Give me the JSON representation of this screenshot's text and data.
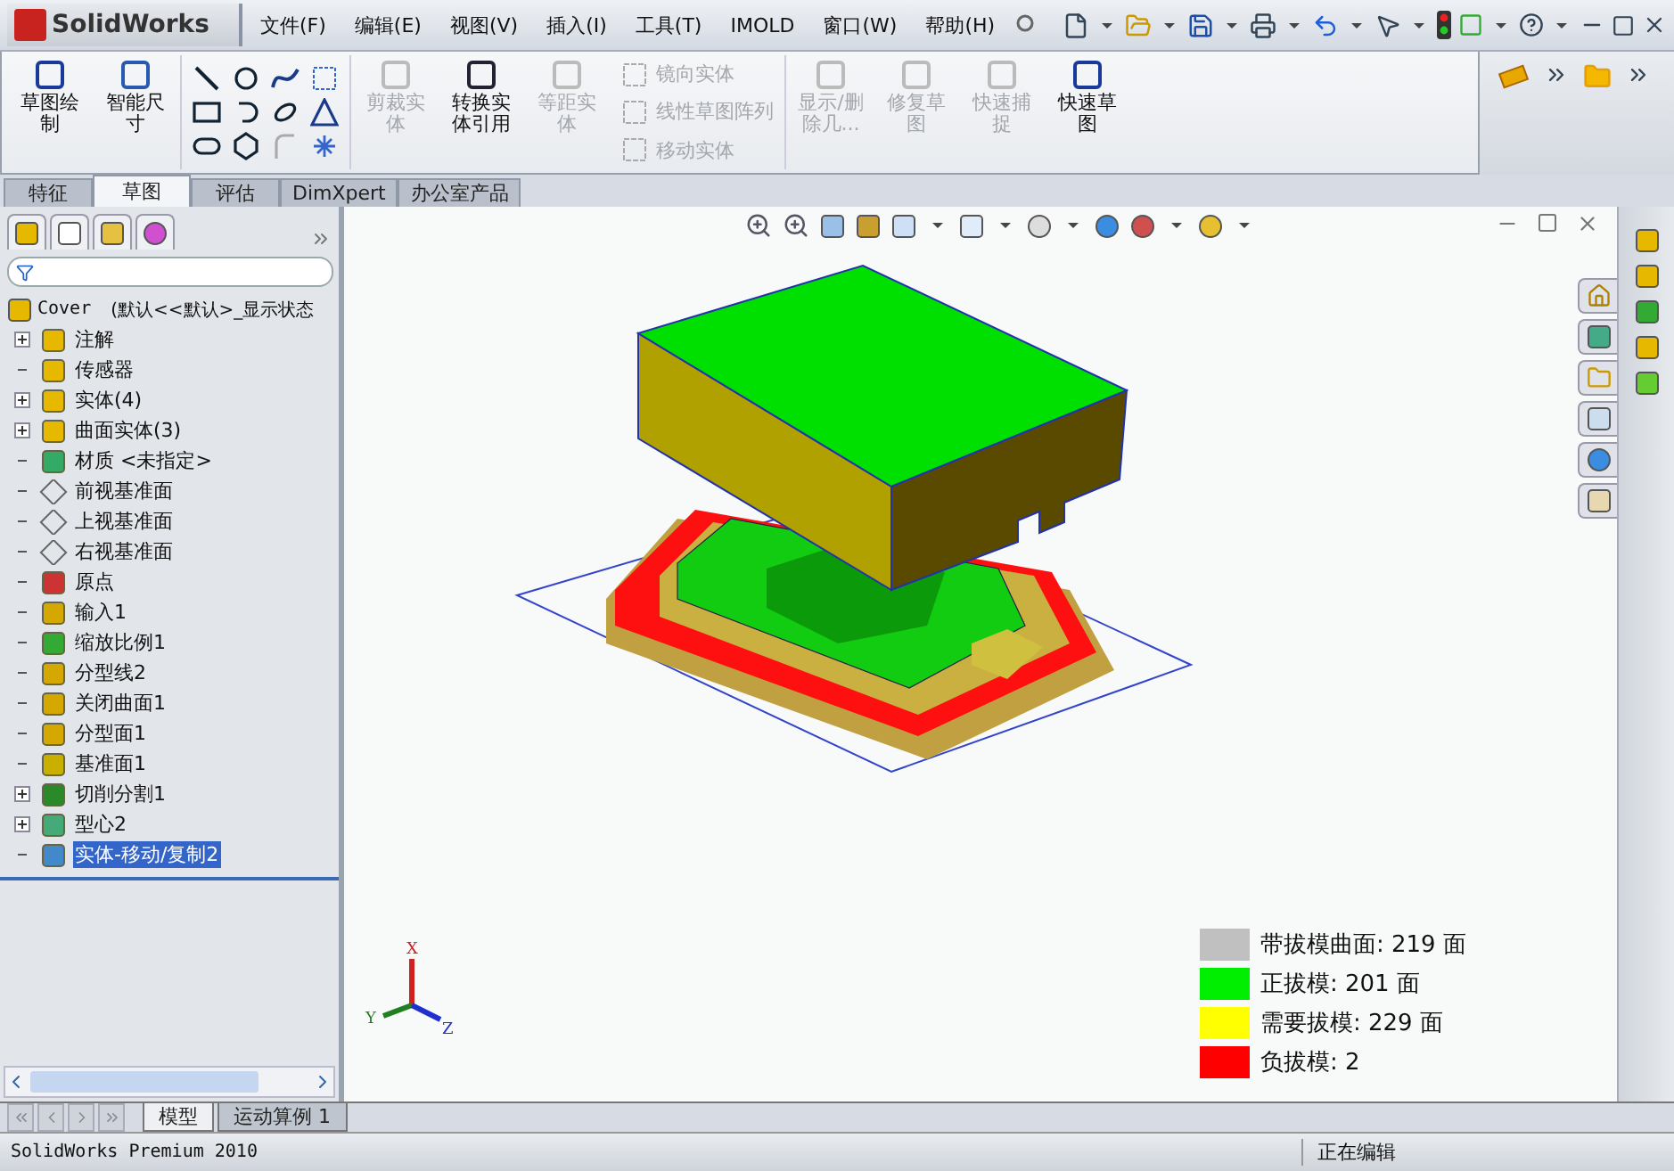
{
  "app": {
    "logo": "SolidWorks"
  },
  "menu": [
    "文件(F)",
    "编辑(E)",
    "视图(V)",
    "插入(I)",
    "工具(T)",
    "IMOLD",
    "窗口(W)",
    "帮助(H)"
  ],
  "ribbon": [
    {
      "kind": "big",
      "label": "草图绘制",
      "disabled": false
    },
    {
      "kind": "big",
      "label": "智能尺寸",
      "disabled": false
    },
    {
      "kind": "tools"
    },
    {
      "kind": "big",
      "label": "剪裁实体",
      "disabled": true
    },
    {
      "kind": "big",
      "label": "转换实体引用",
      "disabled": false
    },
    {
      "kind": "big",
      "label": "等距实体",
      "disabled": true
    },
    {
      "kind": "list",
      "entries": [
        {
          "label": "镜向实体",
          "disabled": true
        },
        {
          "label": "线性草图阵列",
          "disabled": true
        },
        {
          "label": "移动实体",
          "disabled": true
        }
      ]
    },
    {
      "kind": "big",
      "label": "显示/删除几...",
      "disabled": true
    },
    {
      "kind": "big",
      "label": "修复草图",
      "disabled": true
    },
    {
      "kind": "big",
      "label": "快速捕捉",
      "disabled": true
    },
    {
      "kind": "big",
      "label": "快速草图",
      "disabled": false
    }
  ],
  "tabs": [
    {
      "label": "特征",
      "selected": false
    },
    {
      "label": "草图",
      "selected": true
    },
    {
      "label": "评估",
      "selected": false
    },
    {
      "label": "DimXpert",
      "selected": false
    },
    {
      "label": "办公室产品",
      "selected": false
    }
  ],
  "tree": {
    "root": {
      "name": "Cover",
      "config": "(默认<<默认>_显示状态"
    },
    "items": [
      {
        "label": "注解",
        "expandable": true,
        "selected": false
      },
      {
        "label": "传感器",
        "expandable": false,
        "selected": false
      },
      {
        "label": "实体(4)",
        "expandable": true,
        "selected": false
      },
      {
        "label": "曲面实体(3)",
        "expandable": true,
        "selected": false
      },
      {
        "label": "材质 <未指定>",
        "expandable": false,
        "selected": false
      },
      {
        "label": "前视基准面",
        "expandable": false,
        "selected": false
      },
      {
        "label": "上视基准面",
        "expandable": false,
        "selected": false
      },
      {
        "label": "右视基准面",
        "expandable": false,
        "selected": false
      },
      {
        "label": "原点",
        "expandable": false,
        "selected": false
      },
      {
        "label": "输入1",
        "expandable": false,
        "selected": false
      },
      {
        "label": "缩放比例1",
        "expandable": false,
        "selected": false
      },
      {
        "label": "分型线2",
        "expandable": false,
        "selected": false
      },
      {
        "label": "关闭曲面1",
        "expandable": false,
        "selected": false
      },
      {
        "label": "分型面1",
        "expandable": false,
        "selected": false
      },
      {
        "label": "基准面1",
        "expandable": false,
        "selected": false
      },
      {
        "label": "切削分割1",
        "expandable": true,
        "selected": false
      },
      {
        "label": "型心2",
        "expandable": true,
        "selected": false
      },
      {
        "label": "实体-移动/复制2",
        "expandable": false,
        "selected": true
      }
    ]
  },
  "triad": {
    "x": "X",
    "y": "Y",
    "z": "Z"
  },
  "legend": [
    {
      "label": "带拔模曲面: 219 面",
      "color": "#c0c0c0"
    },
    {
      "label": "正拔模: 201 面",
      "color": "#00ee00"
    },
    {
      "label": "需要拔模: 229 面",
      "color": "#ffff00"
    },
    {
      "label": "负拔模: 2",
      "color": "#ff0000"
    }
  ],
  "bottom_tabs": [
    {
      "label": "模型",
      "selected": true
    },
    {
      "label": "运动算例 1",
      "selected": false
    }
  ],
  "status_bar": {
    "product": "SolidWorks Premium 2010",
    "mode": "正在编辑"
  }
}
